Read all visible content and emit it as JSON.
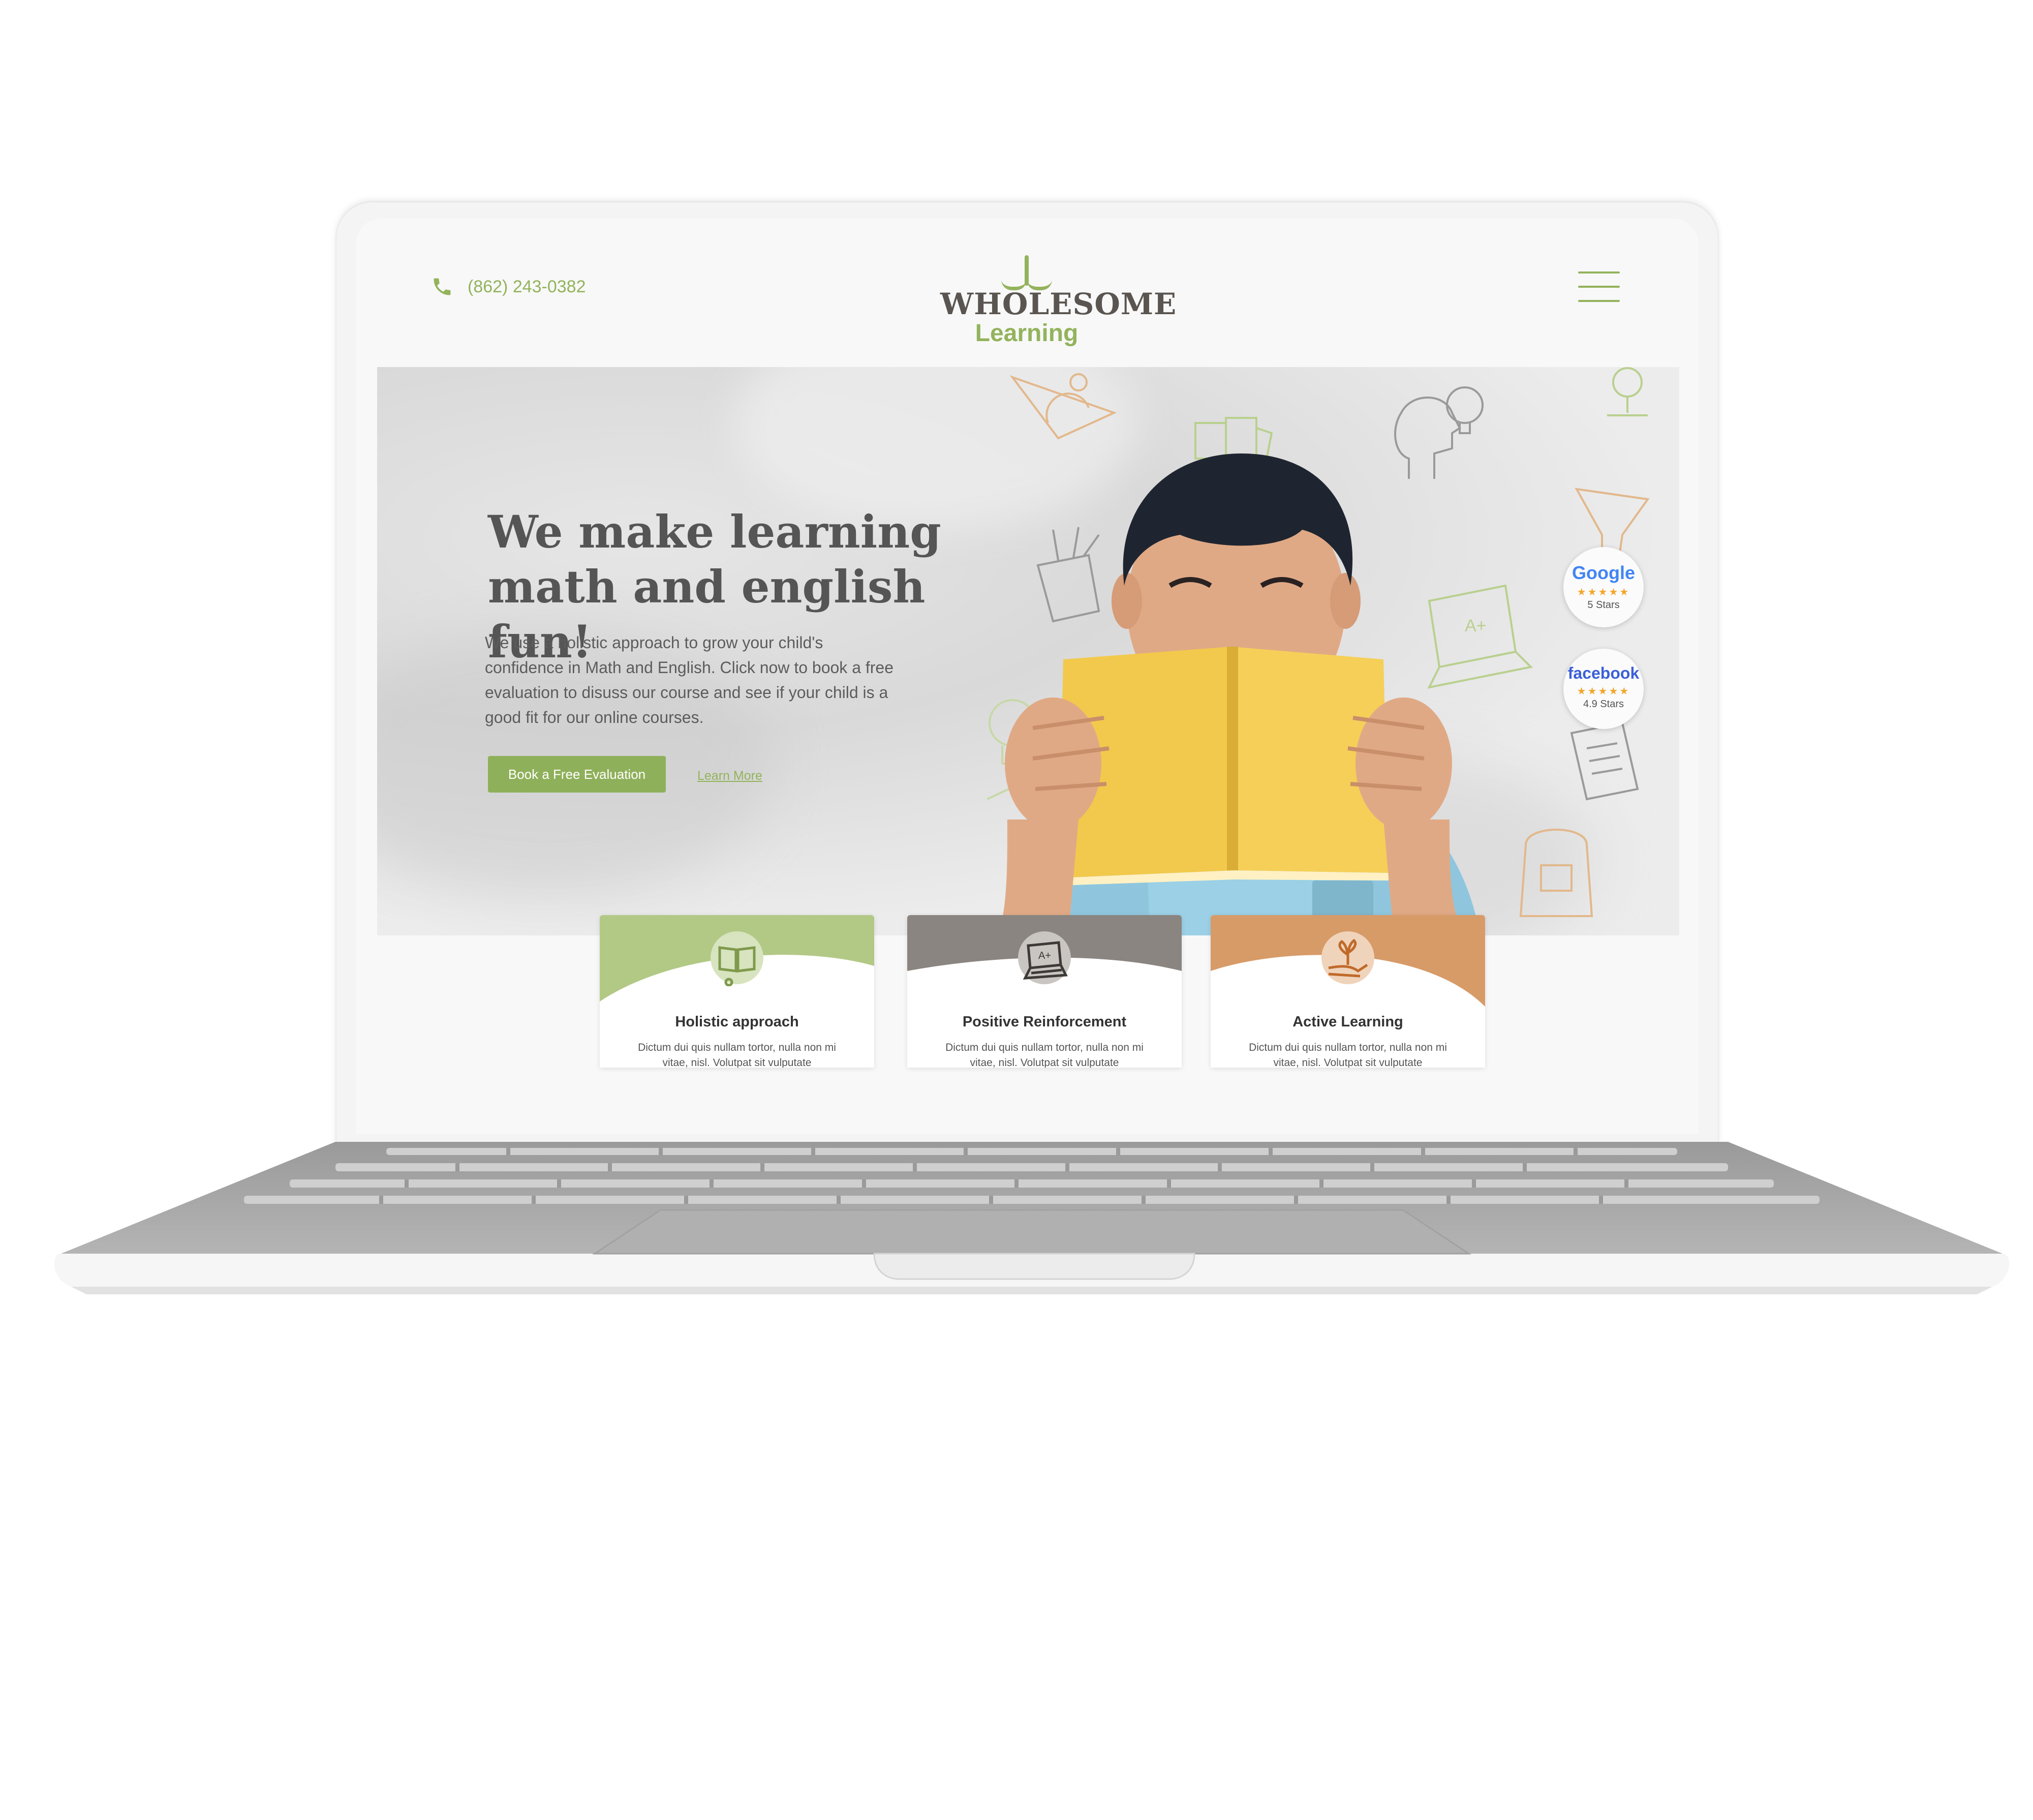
{
  "header": {
    "phone": "(862) 243-0382",
    "phone_icon": "phone-icon",
    "logo": {
      "word1": "WHOLESOME",
      "word2": "Learning"
    },
    "menu_icon": "hamburger-menu-icon"
  },
  "hero": {
    "title": "We make learning math and english fun!",
    "description": "We use a holistic approach to grow your child's confidence in Math and English. Click now to book a free evaluation to disuss our course and see if your child is a good fit for our online courses.",
    "cta_label": "Book a Free Evaluation",
    "learn_more_label": "Learn More"
  },
  "ratings": [
    {
      "brand": "Google",
      "stars": "★★★★★",
      "label": "5 Stars"
    },
    {
      "brand": "facebook",
      "stars": "★★★★★",
      "label": "4.9 Stars"
    }
  ],
  "features": [
    {
      "title": "Holistic approach",
      "text": "Dictum dui quis nullam tortor, nulla non mi vitae, nisl. Volutpat sit vulputate",
      "icon": "book-icon",
      "color": "#b2c986"
    },
    {
      "title": "Positive Reinforcement",
      "text": "Dictum dui quis nullam tortor, nulla non mi vitae, nisl. Volutpat sit vulputate",
      "icon": "laptop-icon",
      "color": "#8a8580"
    },
    {
      "title": "Active Learning",
      "text": "Dictum dui quis nullam tortor, nulla non mi vitae, nisl. Volutpat sit vulputate",
      "icon": "plant-hand-icon",
      "color": "#d79b68"
    }
  ],
  "colors": {
    "accent": "#93b35c",
    "heading": "#555555",
    "google_blue": "#4285f4",
    "facebook_blue": "#3b5fd9",
    "star": "#f4a62a"
  }
}
